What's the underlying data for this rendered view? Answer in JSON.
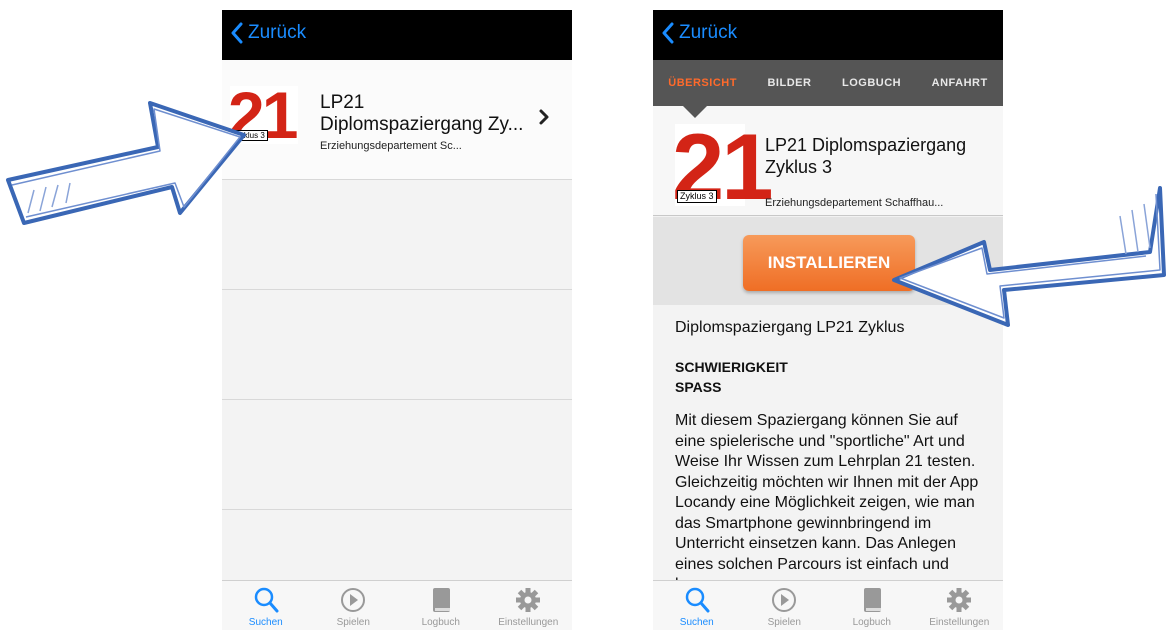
{
  "left": {
    "nav": {
      "back_label": "Zurück"
    },
    "list": [
      {
        "title_line1": "LP21",
        "title_line2": "Diplomspaziergang Zy...",
        "subtitle": "Erziehungsdepartement Sc...",
        "logo_number": "21",
        "logo_badge": "Zyklus 3"
      }
    ],
    "tabs": [
      {
        "label": "Suchen",
        "icon": "search-icon",
        "active": true
      },
      {
        "label": "Spielen",
        "icon": "play-icon",
        "active": false
      },
      {
        "label": "Logbuch",
        "icon": "book-icon",
        "active": false
      },
      {
        "label": "Einstellungen",
        "icon": "gear-icon",
        "active": false
      }
    ]
  },
  "right": {
    "nav": {
      "back_label": "Zurück"
    },
    "segments": [
      "ÜBERSICHT",
      "BILDER",
      "LOGBUCH",
      "ANFAHRT"
    ],
    "active_segment": "ÜBERSICHT",
    "app": {
      "logo_number": "21",
      "logo_badge": "Zyklus 3",
      "title_line1": "LP21 Diplomspaziergang",
      "title_line2": "Zyklus 3",
      "publisher": "Erziehungsdepartement Schaffhau..."
    },
    "install_label": "INSTALLIEREN",
    "description_lead": "Diplomspaziergang LP21 Zyklus",
    "label_difficulty": "SCHWIERIGKEIT",
    "label_fun": "SPASS",
    "description_body": "Mit diesem Spaziergang können Sie auf eine spielerische und \"sportliche\" Art und Weise Ihr Wissen zum Lehrplan 21 testen. Gleichzeitig möchten wir Ihnen mit der App Locandy eine Möglichkeit zeigen, wie man das Smartphone gewinnbringend im Unterricht einsetzen kann. Das Anlegen eines solchen Parcours ist einfach und kann",
    "tabs": [
      {
        "label": "Suchen",
        "icon": "search-icon",
        "active": true
      },
      {
        "label": "Spielen",
        "icon": "play-icon",
        "active": false
      },
      {
        "label": "Logbuch",
        "icon": "book-icon",
        "active": false
      },
      {
        "label": "Einstellungen",
        "icon": "gear-icon",
        "active": false
      }
    ]
  },
  "colors": {
    "accent_blue": "#1a8cff",
    "accent_orange": "#ff6a2b",
    "logo_red": "#d32416",
    "arrow_blue": "#3a67b5"
  }
}
